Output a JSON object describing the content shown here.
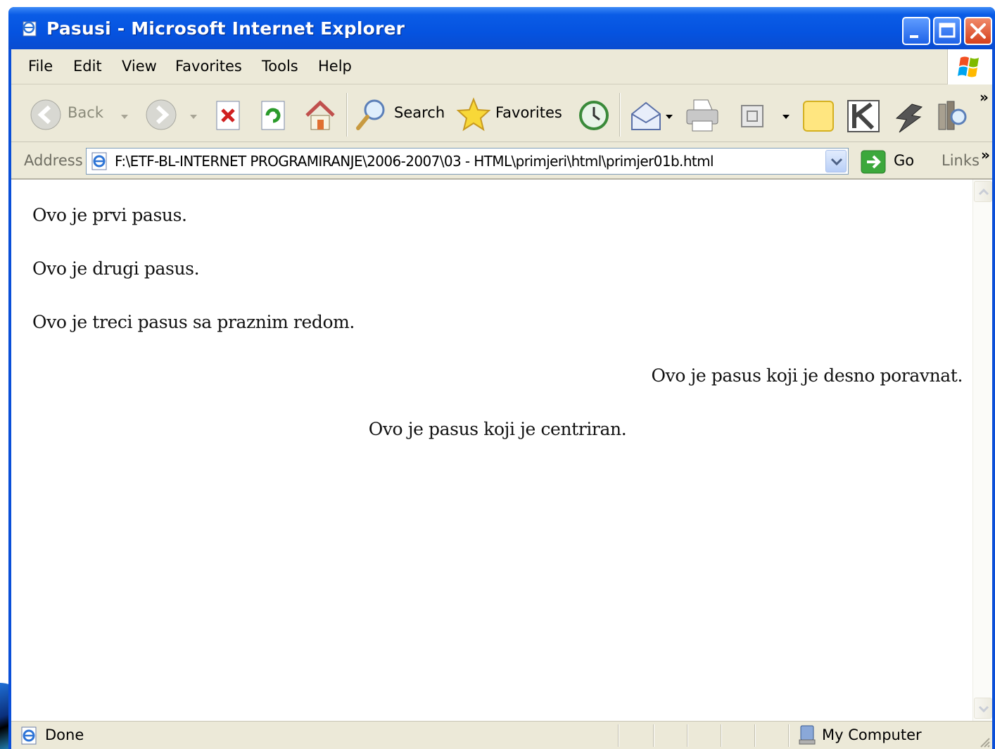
{
  "window": {
    "title": "Pasusi - Microsoft Internet Explorer"
  },
  "menu": {
    "items": [
      "File",
      "Edit",
      "View",
      "Favorites",
      "Tools",
      "Help"
    ]
  },
  "toolbar": {
    "back_label": "Back",
    "search_label": "Search",
    "favorites_label": "Favorites",
    "overflow": "»"
  },
  "address": {
    "label": "Address",
    "value": "F:\\ETF-BL-INTERNET PROGRAMIRANJE\\2006-2007\\03 - HTML\\primjeri\\html\\primjer01b.html",
    "go_label": "Go",
    "links_label": "Links",
    "overflow": "»"
  },
  "page": {
    "paragraphs": [
      {
        "text": "Ovo je prvi pasus.",
        "align": "left"
      },
      {
        "text": "Ovo je drugi pasus.",
        "align": "left"
      },
      {
        "text": "Ovo je treci pasus sa praznim redom.",
        "align": "left"
      },
      {
        "text": "Ovo je pasus koji je desno poravnat.",
        "align": "right"
      },
      {
        "text": "Ovo je pasus koji je centriran.",
        "align": "center"
      }
    ]
  },
  "status": {
    "text": "Done",
    "zone": "My Computer"
  },
  "colors": {
    "titlebar": "#0553e0",
    "chrome": "#ece9d8",
    "close": "#d5401c"
  }
}
